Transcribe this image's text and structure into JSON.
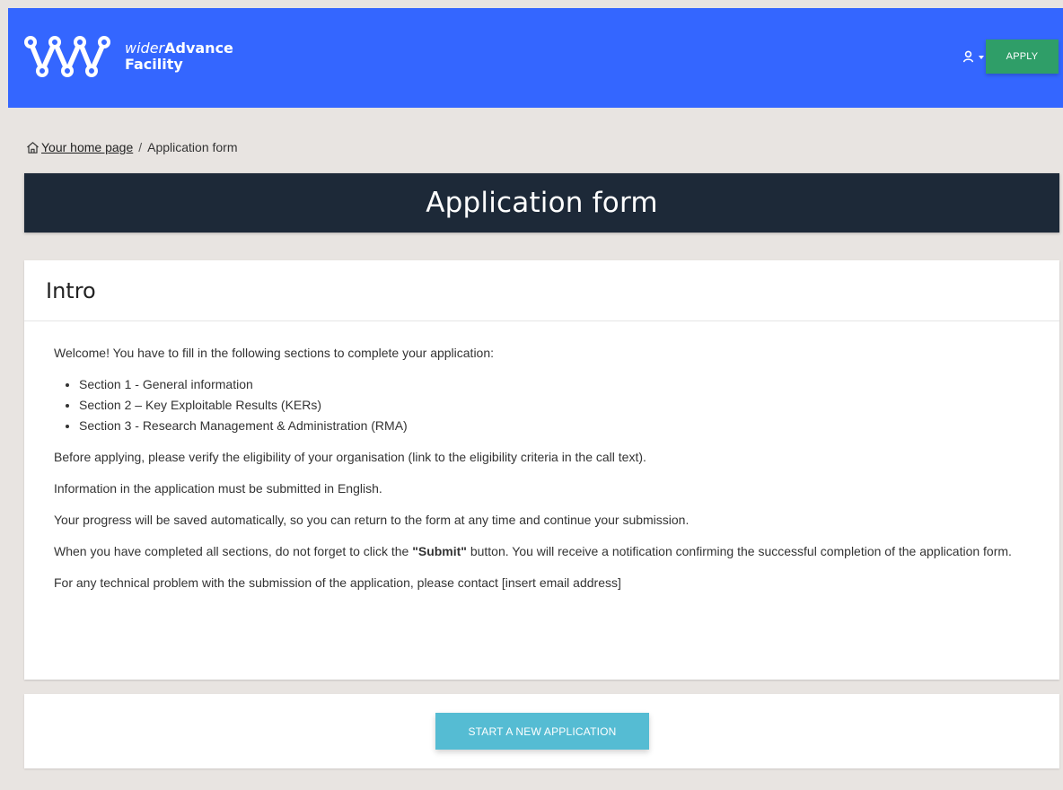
{
  "header": {
    "brand": {
      "line1_light": "wider",
      "line1_bold": "Advance",
      "line2": "Facility",
      "logo_icon": "widera-logo-icon"
    },
    "user_icon": "user-icon",
    "apply_label": "APPLY"
  },
  "breadcrumb": {
    "home_label": "Your home page",
    "separator": "/",
    "current": "Application form"
  },
  "title_banner": {
    "title": "Application form"
  },
  "intro": {
    "heading": "Intro",
    "welcome": "Welcome! You have to fill in the following sections to complete your application:",
    "sections": [
      "Section 1 - General information",
      "Section 2 – Key Exploitable Results (KERs)",
      "Section 3 - Research Management & Administration (RMA)"
    ],
    "eligibility": "Before applying, please verify the eligibility of your organisation (link to the eligibility criteria in the call text).",
    "english": "Information in the application must be submitted in English.",
    "progress": "Your progress will be saved automatically, so you can return to the form at any time and continue your submission.",
    "submit_pre": "When you have completed all sections, do not forget to click the ",
    "submit_label": "\"Submit\"",
    "submit_post": " button. You will receive a notification confirming the successful completion of the application form.",
    "contact": "For any technical problem with the submission of the application, please contact [insert email address]"
  },
  "start": {
    "button_label": "START A NEW APPLICATION"
  },
  "colors": {
    "header": "#3466ff",
    "apply_button": "#2f9e68",
    "banner": "#1d2938",
    "start_button": "#55bcd3",
    "background": "#e8e4e1"
  }
}
